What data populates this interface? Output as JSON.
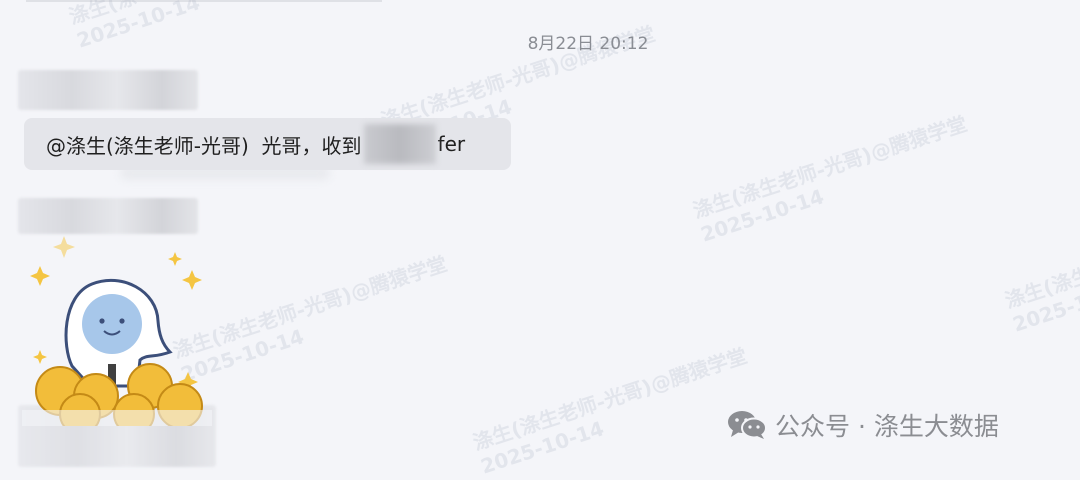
{
  "chat": {
    "timestamp": "8月22日 20:12",
    "message": {
      "before": "@涤生(涤生老师-光哥)  光哥，收到",
      "after": "fer"
    }
  },
  "watermark": {
    "line1": "涤生(涤生老师-光哥)@腾猿学堂",
    "line2": "2025-10-14",
    "fragment_a": "涤生(涤",
    "fragment_b": "2025-10-14",
    "fragment_c": "涤生(涤生老师-光哥)@腾猿学堂",
    "fragment_d": "2025-10-14"
  },
  "footer": {
    "text": "公众号 · 涤生大数据",
    "icon": "wechat-icon"
  },
  "colors": {
    "background": "#f4f5f9",
    "bubble": "#e4e5ea",
    "text": "#1f1f1f",
    "muted": "#8b8d92"
  }
}
